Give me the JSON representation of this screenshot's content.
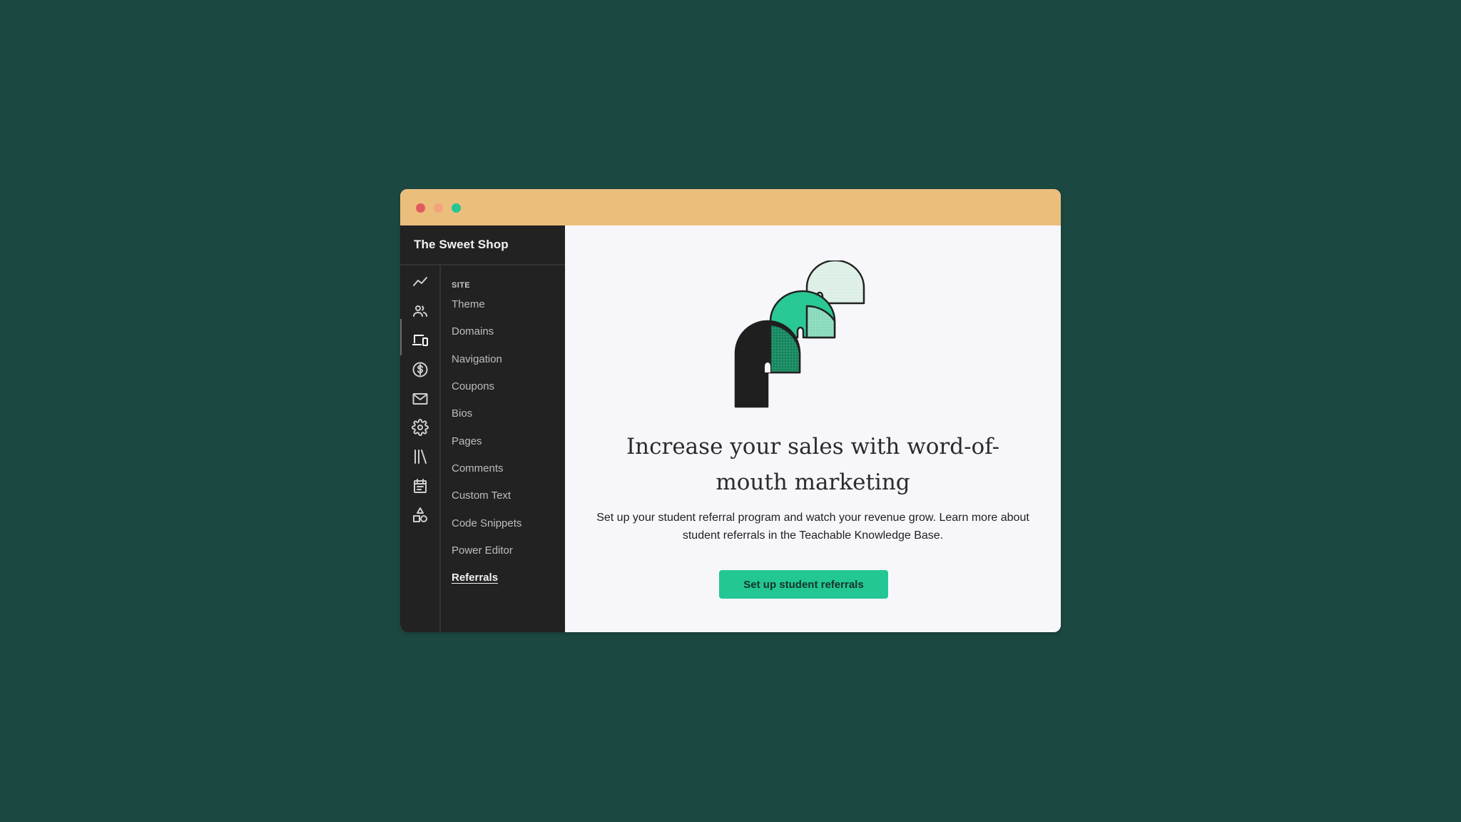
{
  "window": {
    "controls": [
      {
        "name": "close",
        "color": "#e25a60"
      },
      {
        "name": "minimize",
        "color": "#f3a27a"
      },
      {
        "name": "maximize",
        "color": "#22c794"
      }
    ],
    "titlebar_color": "#ecbe7c"
  },
  "sidebar": {
    "brand": "The Sweet Shop",
    "rail_icons": [
      {
        "icon": "trend-line-icon",
        "label": "Analytics",
        "active": false
      },
      {
        "icon": "users-icon",
        "label": "Users",
        "active": false
      },
      {
        "icon": "devices-icon",
        "label": "Site",
        "active": true
      },
      {
        "icon": "dollar-icon",
        "label": "Sales",
        "active": false
      },
      {
        "icon": "mail-icon",
        "label": "Emails",
        "active": false
      },
      {
        "icon": "gear-icon",
        "label": "Settings",
        "active": false
      },
      {
        "icon": "library-icon",
        "label": "Products",
        "active": false
      },
      {
        "icon": "calendar-icon",
        "label": "Calendar",
        "active": false
      },
      {
        "icon": "shapes-icon",
        "label": "Apps",
        "active": false
      }
    ],
    "section_label": "SITE",
    "items": [
      {
        "label": "Theme",
        "active": false
      },
      {
        "label": "Domains",
        "active": false
      },
      {
        "label": "Navigation",
        "active": false
      },
      {
        "label": "Coupons",
        "active": false
      },
      {
        "label": "Bios",
        "active": false
      },
      {
        "label": "Pages",
        "active": false
      },
      {
        "label": "Comments",
        "active": false
      },
      {
        "label": "Custom Text",
        "active": false
      },
      {
        "label": "Code Snippets",
        "active": false
      },
      {
        "label": "Power Editor",
        "active": false
      },
      {
        "label": "Referrals",
        "active": true
      }
    ]
  },
  "main": {
    "illustration": "arches-stairs-illustration",
    "headline": "Increase your sales with word-of-mouth marketing",
    "description": "Set up your student referral program and watch your revenue grow. Learn more about student referrals in the Teachable Knowledge Base.",
    "cta_label": "Set up student referrals",
    "accent_color": "#22c794"
  }
}
